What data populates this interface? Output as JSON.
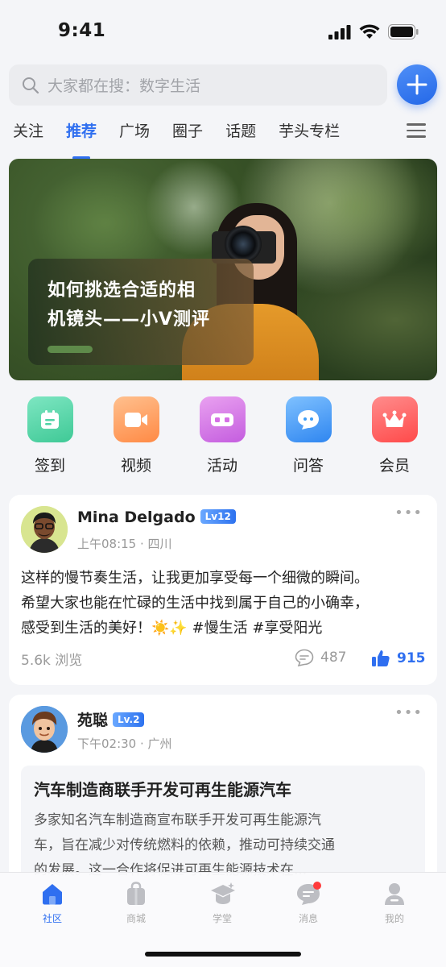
{
  "status_bar": {
    "time": "9:41"
  },
  "search": {
    "placeholder": "大家都在搜：数字生活"
  },
  "tabs": [
    {
      "label": "关注",
      "active": false
    },
    {
      "label": "推荐",
      "active": true
    },
    {
      "label": "广场",
      "active": false
    },
    {
      "label": "圈子",
      "active": false
    },
    {
      "label": "话题",
      "active": false
    },
    {
      "label": "芋头专栏",
      "active": false
    }
  ],
  "banner": {
    "title_line1": "如何挑选合适的相",
    "title_line2": "机镜头——小V测评"
  },
  "quick_actions": [
    {
      "label": "签到",
      "icon": "calendar-icon",
      "color": "#4fd3a6"
    },
    {
      "label": "视频",
      "icon": "video-icon",
      "color": "#ffa15e"
    },
    {
      "label": "活动",
      "icon": "vr-icon",
      "color": "#d56fe6"
    },
    {
      "label": "问答",
      "icon": "chat-icon",
      "color": "#3d9bf5"
    },
    {
      "label": "会员",
      "icon": "crown-icon",
      "color": "#ff5c5c"
    }
  ],
  "posts": [
    {
      "author": "Mina Delgado",
      "level": "Lv12",
      "meta": "上午08:15 · 四川",
      "text_lines": [
        "这样的慢节奏生活，让我更加享受每一个细微的瞬间。",
        "希望大家也能在忙碌的生活中找到属于自己的小确幸，",
        "感受到生活的美好！☀️✨ #慢生活 #享受阳光"
      ],
      "views": "5.6k 浏览",
      "comments": "487",
      "likes": "915"
    },
    {
      "author": "苑聪",
      "level": "Lv.2",
      "meta": "下午02:30 · 广州",
      "quote_title": "汽车制造商联手开发可再生能源汽车",
      "quote_lines": [
        "多家知名汽车制造商宣布联手开发可再生能源汽",
        "车，旨在减少对传统燃料的依赖，推动可持续交通",
        "的发展。这一合作将促进可再生能源技术在..."
      ]
    }
  ],
  "bottom_nav": [
    {
      "label": "社区",
      "icon": "home-icon",
      "active": true
    },
    {
      "label": "商城",
      "icon": "shopping-bag-icon",
      "active": false
    },
    {
      "label": "学堂",
      "icon": "graduation-cap-icon",
      "active": false
    },
    {
      "label": "消息",
      "icon": "message-icon",
      "active": false,
      "badge": true
    },
    {
      "label": "我的",
      "icon": "profile-icon",
      "active": false
    }
  ],
  "colors": {
    "accent": "#2f6ff0"
  }
}
